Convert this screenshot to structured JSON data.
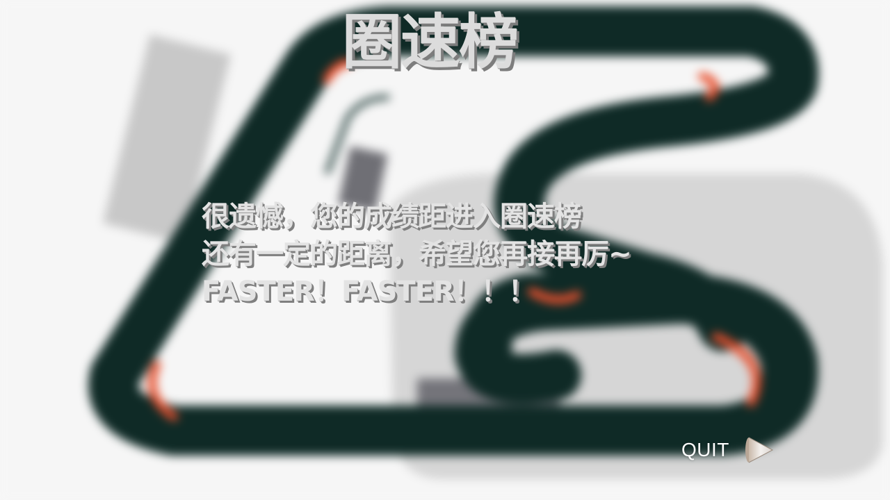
{
  "screen": {
    "title": "圈速榜",
    "message_lines": [
      "很遗憾，您的成绩距进入圈速榜",
      "还有一定的距离，希望您再接再厉~",
      "FASTER！FASTER！！！"
    ]
  },
  "controls": {
    "quit_label": "QUIT",
    "quit_icon": "play-arrow-icon"
  },
  "colors": {
    "track": "#0f2a26",
    "curb": "#e8502e",
    "infield": "#d6d6d6",
    "building": "#7a7a80",
    "text": "#e3e3e3",
    "text_shadow": "#7f7f7f"
  }
}
